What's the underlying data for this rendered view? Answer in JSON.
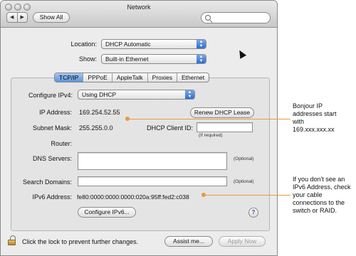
{
  "window": {
    "title": "Network",
    "show_all_label": "Show All",
    "search_placeholder": ""
  },
  "location": {
    "label": "Location:",
    "value": "DHCP Automatic"
  },
  "show": {
    "label": "Show:",
    "value": "Built-in Ethernet"
  },
  "tabs": [
    {
      "label": "TCP/IP",
      "active": true
    },
    {
      "label": "PPPoE",
      "active": false
    },
    {
      "label": "AppleTalk",
      "active": false
    },
    {
      "label": "Proxies",
      "active": false
    },
    {
      "label": "Ethernet",
      "active": false
    }
  ],
  "configure_ipv4": {
    "label": "Configure IPv4:",
    "value": "Using DHCP"
  },
  "ip_address": {
    "label": "IP Address:",
    "value": "169.254.52.55"
  },
  "renew_label": "Renew DHCP Lease",
  "subnet_mask": {
    "label": "Subnet Mask:",
    "value": "255.255.0.0"
  },
  "dhcp_client_id": {
    "label": "DHCP Client ID:",
    "value": "",
    "note": "(If required)"
  },
  "router": {
    "label": "Router:",
    "value": ""
  },
  "dns_servers": {
    "label": "DNS Servers:",
    "value": "",
    "optional": "(Optional)"
  },
  "search_domains": {
    "label": "Search Domains:",
    "value": "",
    "optional": "(Optional)"
  },
  "ipv6_address": {
    "label": "IPv6 Address:",
    "value": "fe80:0000:0000:0000:020a:95ff:fed2:c038"
  },
  "configure_ipv6_label": "Configure IPv6...",
  "help_label": "?",
  "footer": {
    "lock_text": "Click the lock to prevent further changes.",
    "assist_label": "Assist me...",
    "apply_label": "Apply Now"
  },
  "callouts": {
    "bonjour": "Bonjour IP\naddresses start\nwith\n169.xxx.xxx.xx",
    "ipv6": "If you don't see an\nIPv6 Address, check\nyour cable\nconnections to the\nswitch or RAID."
  },
  "colors": {
    "accent": "#2d6fd0",
    "callout": "#e89a3c"
  }
}
